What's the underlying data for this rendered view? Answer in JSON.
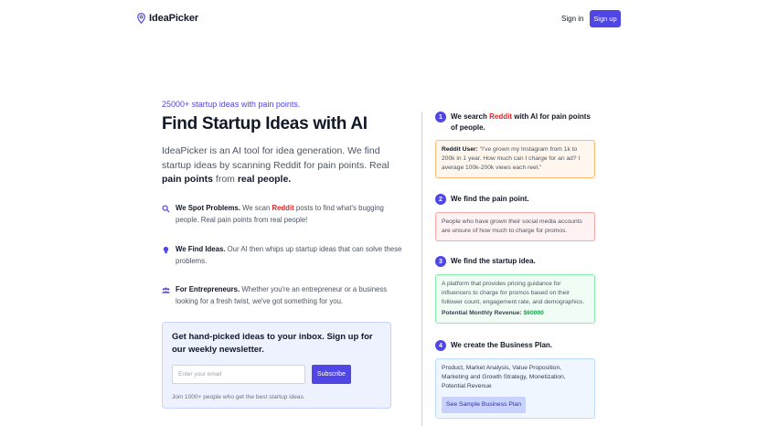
{
  "header": {
    "logo_text": "IdeaPicker",
    "signin_label": "Sign in",
    "signup_label": "Sign up"
  },
  "hero": {
    "tagline": "25000+ startup ideas with pain points.",
    "title": "Find Startup Ideas with AI",
    "intro_part1": "IdeaPicker is an AI tool for idea generation. We find startup ideas by scanning Reddit for pain points. Real ",
    "intro_bold1": "pain points",
    "intro_part2": " from ",
    "intro_bold2": "real people."
  },
  "features": [
    {
      "icon": "search-icon",
      "title": "We Spot Problems.",
      "text_a": " We scan ",
      "highlight": "Reddit",
      "text_b": " posts to find what's bugging people. Real pain points from real people!"
    },
    {
      "icon": "lightbulb-icon",
      "title": "We Find Ideas.",
      "text": " Our AI then whips up startup ideas that can solve these problems."
    },
    {
      "icon": "users-icon",
      "title": "For Entrepreneurs.",
      "text": " Whether you're an entrepreneur or a business looking for a fresh twist, we've got something for you."
    }
  ],
  "newsletter": {
    "title": "Get hand-picked ideas to your inbox. Sign up for our weekly newsletter.",
    "placeholder": "Enter your email",
    "button_label": "Subscribe",
    "note": "Join 1000+ people who get the best startup ideas."
  },
  "steps": [
    {
      "number": "1",
      "title_a": "We search ",
      "title_highlight": "Reddit",
      "title_b": " with AI for pain points of people.",
      "box_label": "Reddit User:",
      "box_text": " \"I've grown my Instagram from 1k to 200k in 1 year. How much can I charge for an ad? I average 100k-200k views each reel.\""
    },
    {
      "number": "2",
      "title": "We find the pain point.",
      "box_text": "People who have grown their social media accounts are unsure of how much to charge for promos."
    },
    {
      "number": "3",
      "title": "We find the startup idea.",
      "box_text": "A platform that provides pricing guidance for influencers to charge for promos based on their follower count, engagement rate, and demographics.",
      "revenue_label": "Potential Monthly Revenue:",
      "revenue_value": "$60000"
    },
    {
      "number": "4",
      "title": "We create the Business Plan.",
      "box_text": "Product, Market Analysis, Value Proposition, Marketing and Growth Strategy, Monetization, Potential Revenue",
      "button_label": "See Sample Business Plan"
    }
  ],
  "colors": {
    "accent": "#4f46e5",
    "highlight_red": "#dc2626",
    "revenue_green": "#16a34a"
  }
}
